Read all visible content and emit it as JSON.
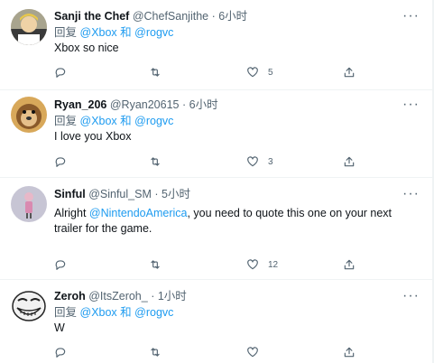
{
  "tweets": [
    {
      "name": "Sanji the Chef",
      "handle": "@ChefSanjithe",
      "time": "6小时",
      "reply_prefix": "回复",
      "reply_to_1": "@Xbox",
      "reply_and": "和",
      "reply_to_2": "@rogvc",
      "text": "Xbox so nice",
      "likes": "5"
    },
    {
      "name": "Ryan_206",
      "handle": "@Ryan20615",
      "time": "6小时",
      "reply_prefix": "回复",
      "reply_to_1": "@Xbox",
      "reply_and": "和",
      "reply_to_2": "@rogvc",
      "text": "I love you Xbox",
      "likes": "3"
    },
    {
      "name": "Sinful",
      "handle": "@Sinful_SM",
      "time": "5小时",
      "text_prefix": "Alright ",
      "mention": "@NintendoAmerica",
      "text_suffix": ", you need to quote this one on your next trailer for the game.",
      "likes": "12"
    },
    {
      "name": "Zeroh",
      "handle": "@ItsZeroh_",
      "time": "1小时",
      "reply_prefix": "回复",
      "reply_to_1": "@Xbox",
      "reply_and": "和",
      "reply_to_2": "@rogvc",
      "text": "W",
      "likes": ""
    }
  ],
  "separator": "·",
  "icons": {
    "more": "more-icon",
    "reply": "reply-icon",
    "retweet": "retweet-icon",
    "like": "like-icon",
    "share": "share-icon"
  },
  "colors": {
    "link": "#1d9bf0",
    "secondary": "#536471",
    "primary": "#0f1419",
    "divider": "#eff3f4"
  }
}
